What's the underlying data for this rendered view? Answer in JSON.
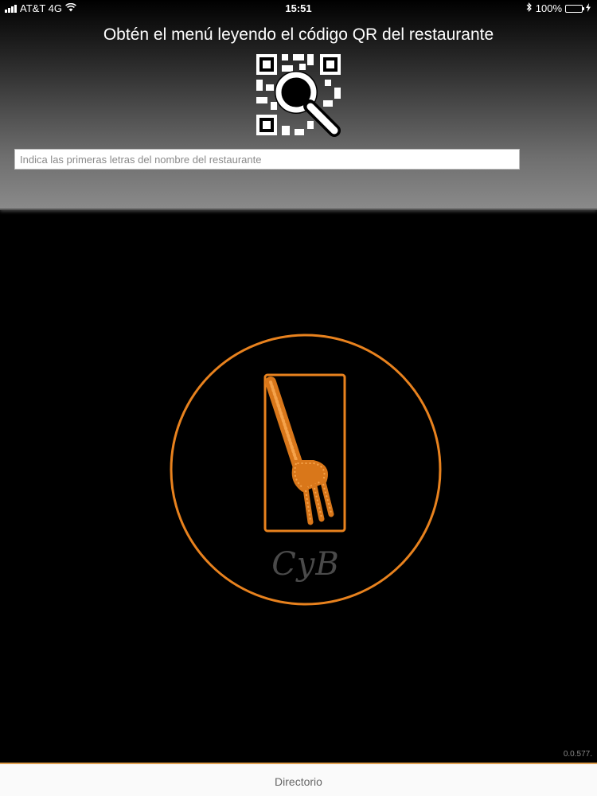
{
  "status_bar": {
    "carrier": "AT&T 4G",
    "time": "15:51",
    "battery": "100%",
    "icons": [
      "signal-icon",
      "wifi-icon",
      "bluetooth-icon",
      "battery-icon",
      "charging-icon"
    ]
  },
  "header": {
    "title": "Obtén el menú leyendo el código QR del restaurante",
    "qr_button_icon": "qr-search-icon"
  },
  "search": {
    "placeholder": "Indica las primeras letras del nombre del restaurante",
    "value": ""
  },
  "logo": {
    "text": "CyB",
    "icon": "fork-icon"
  },
  "version": "0.0.577.",
  "tab_bar": {
    "directorio_label": "Directorio"
  },
  "colors": {
    "accent": "#e8821e",
    "battery": "#4cd964",
    "logo_text": "#4a4a4a"
  }
}
